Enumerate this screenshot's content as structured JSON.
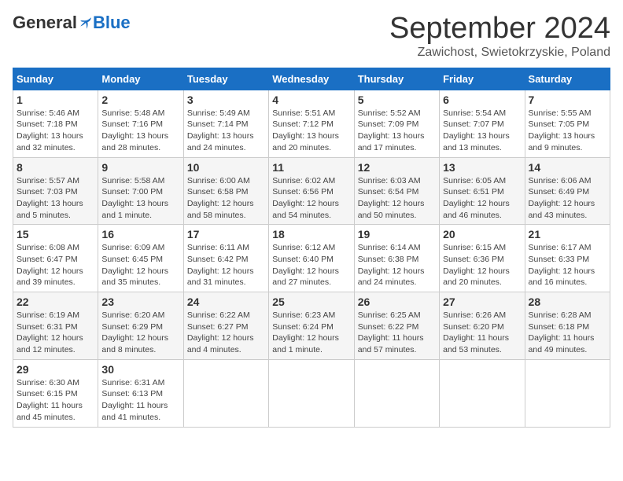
{
  "header": {
    "logo": {
      "general": "General",
      "blue": "Blue"
    },
    "title": "September 2024",
    "location": "Zawichost, Swietokrzyskie, Poland"
  },
  "days_of_week": [
    "Sunday",
    "Monday",
    "Tuesday",
    "Wednesday",
    "Thursday",
    "Friday",
    "Saturday"
  ],
  "weeks": [
    [
      {
        "day": "1",
        "info": "Sunrise: 5:46 AM\nSunset: 7:18 PM\nDaylight: 13 hours and 32 minutes."
      },
      {
        "day": "2",
        "info": "Sunrise: 5:48 AM\nSunset: 7:16 PM\nDaylight: 13 hours and 28 minutes."
      },
      {
        "day": "3",
        "info": "Sunrise: 5:49 AM\nSunset: 7:14 PM\nDaylight: 13 hours and 24 minutes."
      },
      {
        "day": "4",
        "info": "Sunrise: 5:51 AM\nSunset: 7:12 PM\nDaylight: 13 hours and 20 minutes."
      },
      {
        "day": "5",
        "info": "Sunrise: 5:52 AM\nSunset: 7:09 PM\nDaylight: 13 hours and 17 minutes."
      },
      {
        "day": "6",
        "info": "Sunrise: 5:54 AM\nSunset: 7:07 PM\nDaylight: 13 hours and 13 minutes."
      },
      {
        "day": "7",
        "info": "Sunrise: 5:55 AM\nSunset: 7:05 PM\nDaylight: 13 hours and 9 minutes."
      }
    ],
    [
      {
        "day": "8",
        "info": "Sunrise: 5:57 AM\nSunset: 7:03 PM\nDaylight: 13 hours and 5 minutes."
      },
      {
        "day": "9",
        "info": "Sunrise: 5:58 AM\nSunset: 7:00 PM\nDaylight: 13 hours and 1 minute."
      },
      {
        "day": "10",
        "info": "Sunrise: 6:00 AM\nSunset: 6:58 PM\nDaylight: 12 hours and 58 minutes."
      },
      {
        "day": "11",
        "info": "Sunrise: 6:02 AM\nSunset: 6:56 PM\nDaylight: 12 hours and 54 minutes."
      },
      {
        "day": "12",
        "info": "Sunrise: 6:03 AM\nSunset: 6:54 PM\nDaylight: 12 hours and 50 minutes."
      },
      {
        "day": "13",
        "info": "Sunrise: 6:05 AM\nSunset: 6:51 PM\nDaylight: 12 hours and 46 minutes."
      },
      {
        "day": "14",
        "info": "Sunrise: 6:06 AM\nSunset: 6:49 PM\nDaylight: 12 hours and 43 minutes."
      }
    ],
    [
      {
        "day": "15",
        "info": "Sunrise: 6:08 AM\nSunset: 6:47 PM\nDaylight: 12 hours and 39 minutes."
      },
      {
        "day": "16",
        "info": "Sunrise: 6:09 AM\nSunset: 6:45 PM\nDaylight: 12 hours and 35 minutes."
      },
      {
        "day": "17",
        "info": "Sunrise: 6:11 AM\nSunset: 6:42 PM\nDaylight: 12 hours and 31 minutes."
      },
      {
        "day": "18",
        "info": "Sunrise: 6:12 AM\nSunset: 6:40 PM\nDaylight: 12 hours and 27 minutes."
      },
      {
        "day": "19",
        "info": "Sunrise: 6:14 AM\nSunset: 6:38 PM\nDaylight: 12 hours and 24 minutes."
      },
      {
        "day": "20",
        "info": "Sunrise: 6:15 AM\nSunset: 6:36 PM\nDaylight: 12 hours and 20 minutes."
      },
      {
        "day": "21",
        "info": "Sunrise: 6:17 AM\nSunset: 6:33 PM\nDaylight: 12 hours and 16 minutes."
      }
    ],
    [
      {
        "day": "22",
        "info": "Sunrise: 6:19 AM\nSunset: 6:31 PM\nDaylight: 12 hours and 12 minutes."
      },
      {
        "day": "23",
        "info": "Sunrise: 6:20 AM\nSunset: 6:29 PM\nDaylight: 12 hours and 8 minutes."
      },
      {
        "day": "24",
        "info": "Sunrise: 6:22 AM\nSunset: 6:27 PM\nDaylight: 12 hours and 4 minutes."
      },
      {
        "day": "25",
        "info": "Sunrise: 6:23 AM\nSunset: 6:24 PM\nDaylight: 12 hours and 1 minute."
      },
      {
        "day": "26",
        "info": "Sunrise: 6:25 AM\nSunset: 6:22 PM\nDaylight: 11 hours and 57 minutes."
      },
      {
        "day": "27",
        "info": "Sunrise: 6:26 AM\nSunset: 6:20 PM\nDaylight: 11 hours and 53 minutes."
      },
      {
        "day": "28",
        "info": "Sunrise: 6:28 AM\nSunset: 6:18 PM\nDaylight: 11 hours and 49 minutes."
      }
    ],
    [
      {
        "day": "29",
        "info": "Sunrise: 6:30 AM\nSunset: 6:15 PM\nDaylight: 11 hours and 45 minutes."
      },
      {
        "day": "30",
        "info": "Sunrise: 6:31 AM\nSunset: 6:13 PM\nDaylight: 11 hours and 41 minutes."
      },
      null,
      null,
      null,
      null,
      null
    ]
  ]
}
